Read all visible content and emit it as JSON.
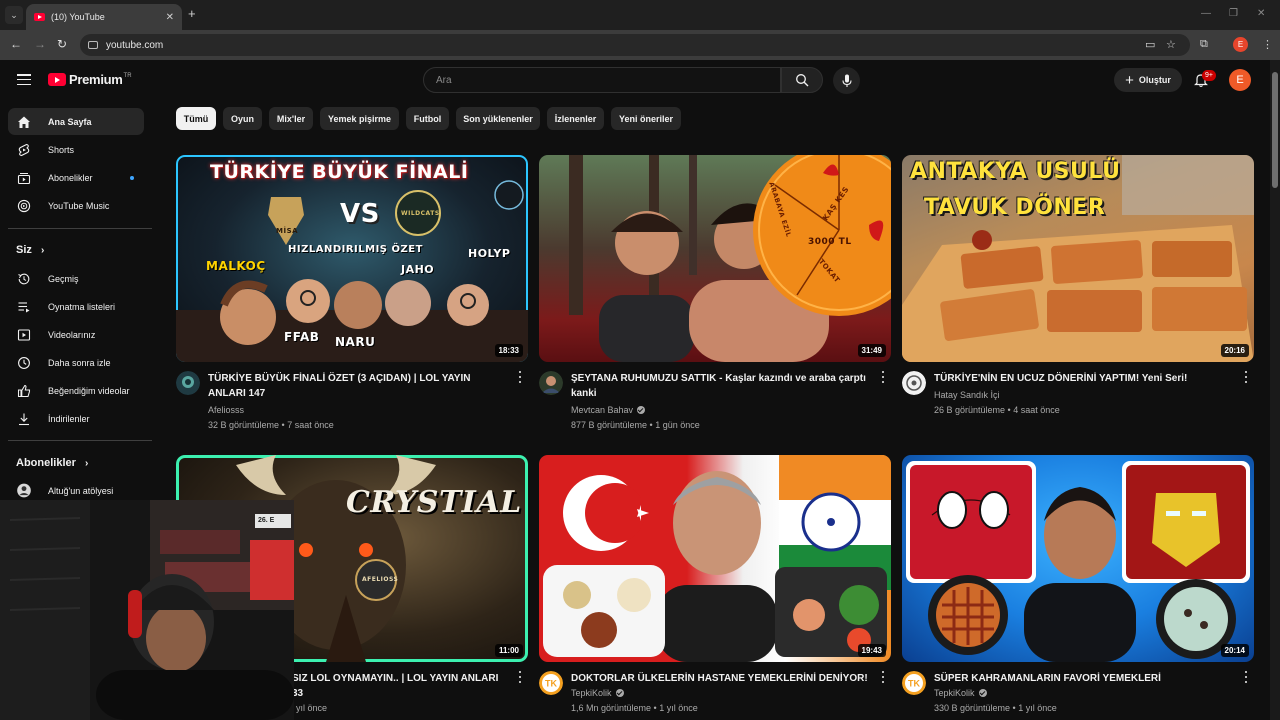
{
  "browser": {
    "tab_title": "(10) YouTube",
    "close_glyph": "✕",
    "newtab_glyph": "+",
    "address": "youtube.com",
    "profile_initial": "E",
    "min_glyph": "—",
    "restore_glyph": "❐",
    "close_window_glyph": "✕"
  },
  "header": {
    "brand": "Premium",
    "brand_sup": "TR",
    "search_placeholder": "Ara",
    "create_label": "Oluştur",
    "notif_count": "9+",
    "avatar_initial": "E"
  },
  "sidebar": {
    "main": [
      {
        "label": "Ana Sayfa",
        "icon": "home-icon"
      },
      {
        "label": "Shorts",
        "icon": "shorts-icon"
      },
      {
        "label": "Abonelikler",
        "icon": "subscriptions-icon"
      },
      {
        "label": "YouTube Music",
        "icon": "music-icon"
      }
    ],
    "you_heading": "Siz",
    "you": [
      {
        "label": "Geçmiş",
        "icon": "history-icon"
      },
      {
        "label": "Oynatma listeleri",
        "icon": "playlist-icon"
      },
      {
        "label": "Videolarınız",
        "icon": "your-videos-icon"
      },
      {
        "label": "Daha sonra izle",
        "icon": "watch-later-icon"
      },
      {
        "label": "Beğendiğim videolar",
        "icon": "like-icon"
      },
      {
        "label": "İndirilenler",
        "icon": "download-icon"
      }
    ],
    "subs_heading": "Abonelikler",
    "subs": [
      {
        "label": "Altuğ'un atölyesi"
      }
    ]
  },
  "chips": [
    "Tümü",
    "Oyun",
    "Mix'ler",
    "Yemek pişirme",
    "Futbol",
    "Son yüklenenler",
    "İzlenenler",
    "Yeni öneriler"
  ],
  "videos": [
    {
      "title": "TÜRKİYE BÜYÜK FİNALİ ÖZET (3 AÇIDAN) | LOL YAYIN ANLARI 147",
      "channel": "Afeliosss",
      "meta": "32 B görüntüleme • 7 saat önce",
      "duration": "18:33",
      "thumb": {
        "l1": "TÜRKİYE BÜYÜK FİNALİ",
        "l2": "MİSA",
        "l3": "VS",
        "l4": "WILDCATS",
        "l5": "HIZLANDIRILMIŞ ÖZET",
        "l6": "MALKOÇ",
        "l7": "JAHO",
        "l8": "HOLYP",
        "l9": "FFAB",
        "l10": "NARU"
      }
    },
    {
      "title": "ŞEYTANA RUHUMUZU SATTIK - Kaşlar kazındı ve araba çarptı kanki",
      "channel": "Mevtcan Bahav",
      "meta": "877 B görüntüleme • 1 gün önce",
      "duration": "31:49",
      "thumb": {
        "w1": "ARABAYA EZİL",
        "w2": "KAŞ KES",
        "w3": "3000 TL",
        "w4": "TOKAT"
      }
    },
    {
      "title": "TÜRKİYE'NİN EN UCUZ DÖNERİNİ YAPTIM! Yeni Seri!",
      "channel": "Hatay Sandık İçi",
      "meta": "26 B görüntüleme • 4 saat önce",
      "duration": "20:16",
      "thumb": {
        "l1": "ANTAKYA USULÜ",
        "l2": "TAVUK DÖNER"
      }
    },
    {
      "title": "SIZ LOL OYNAMAYIN.. | LOL YAYIN ANLARI 33",
      "channel": "",
      "meta": "yıl önce",
      "duration": "11:00",
      "thumb": {
        "l1": "CRYSTIAL",
        "l2": "AFELIOSS"
      }
    },
    {
      "title": "DOKTORLAR ÜLKELERİN HASTANE YEMEKLERİNİ DENİYOR!",
      "channel": "TepkiKolik",
      "meta": "1,6 Mn görüntüleme • 1 yıl önce",
      "duration": "19:43",
      "thumb": {}
    },
    {
      "title": "SÜPER KAHRAMANLARIN FAVORİ YEMEKLERİ",
      "channel": "TepkiKolik",
      "meta": "330 B görüntüleme • 1 yıl önce",
      "duration": "20:14",
      "thumb": {}
    }
  ],
  "webcam": {
    "sign": "26. E"
  },
  "colors": {
    "brand_red": "#ff0033",
    "avatar_orange": "#ef5a28",
    "bg": "#0f0f0f",
    "chip": "#272727"
  }
}
